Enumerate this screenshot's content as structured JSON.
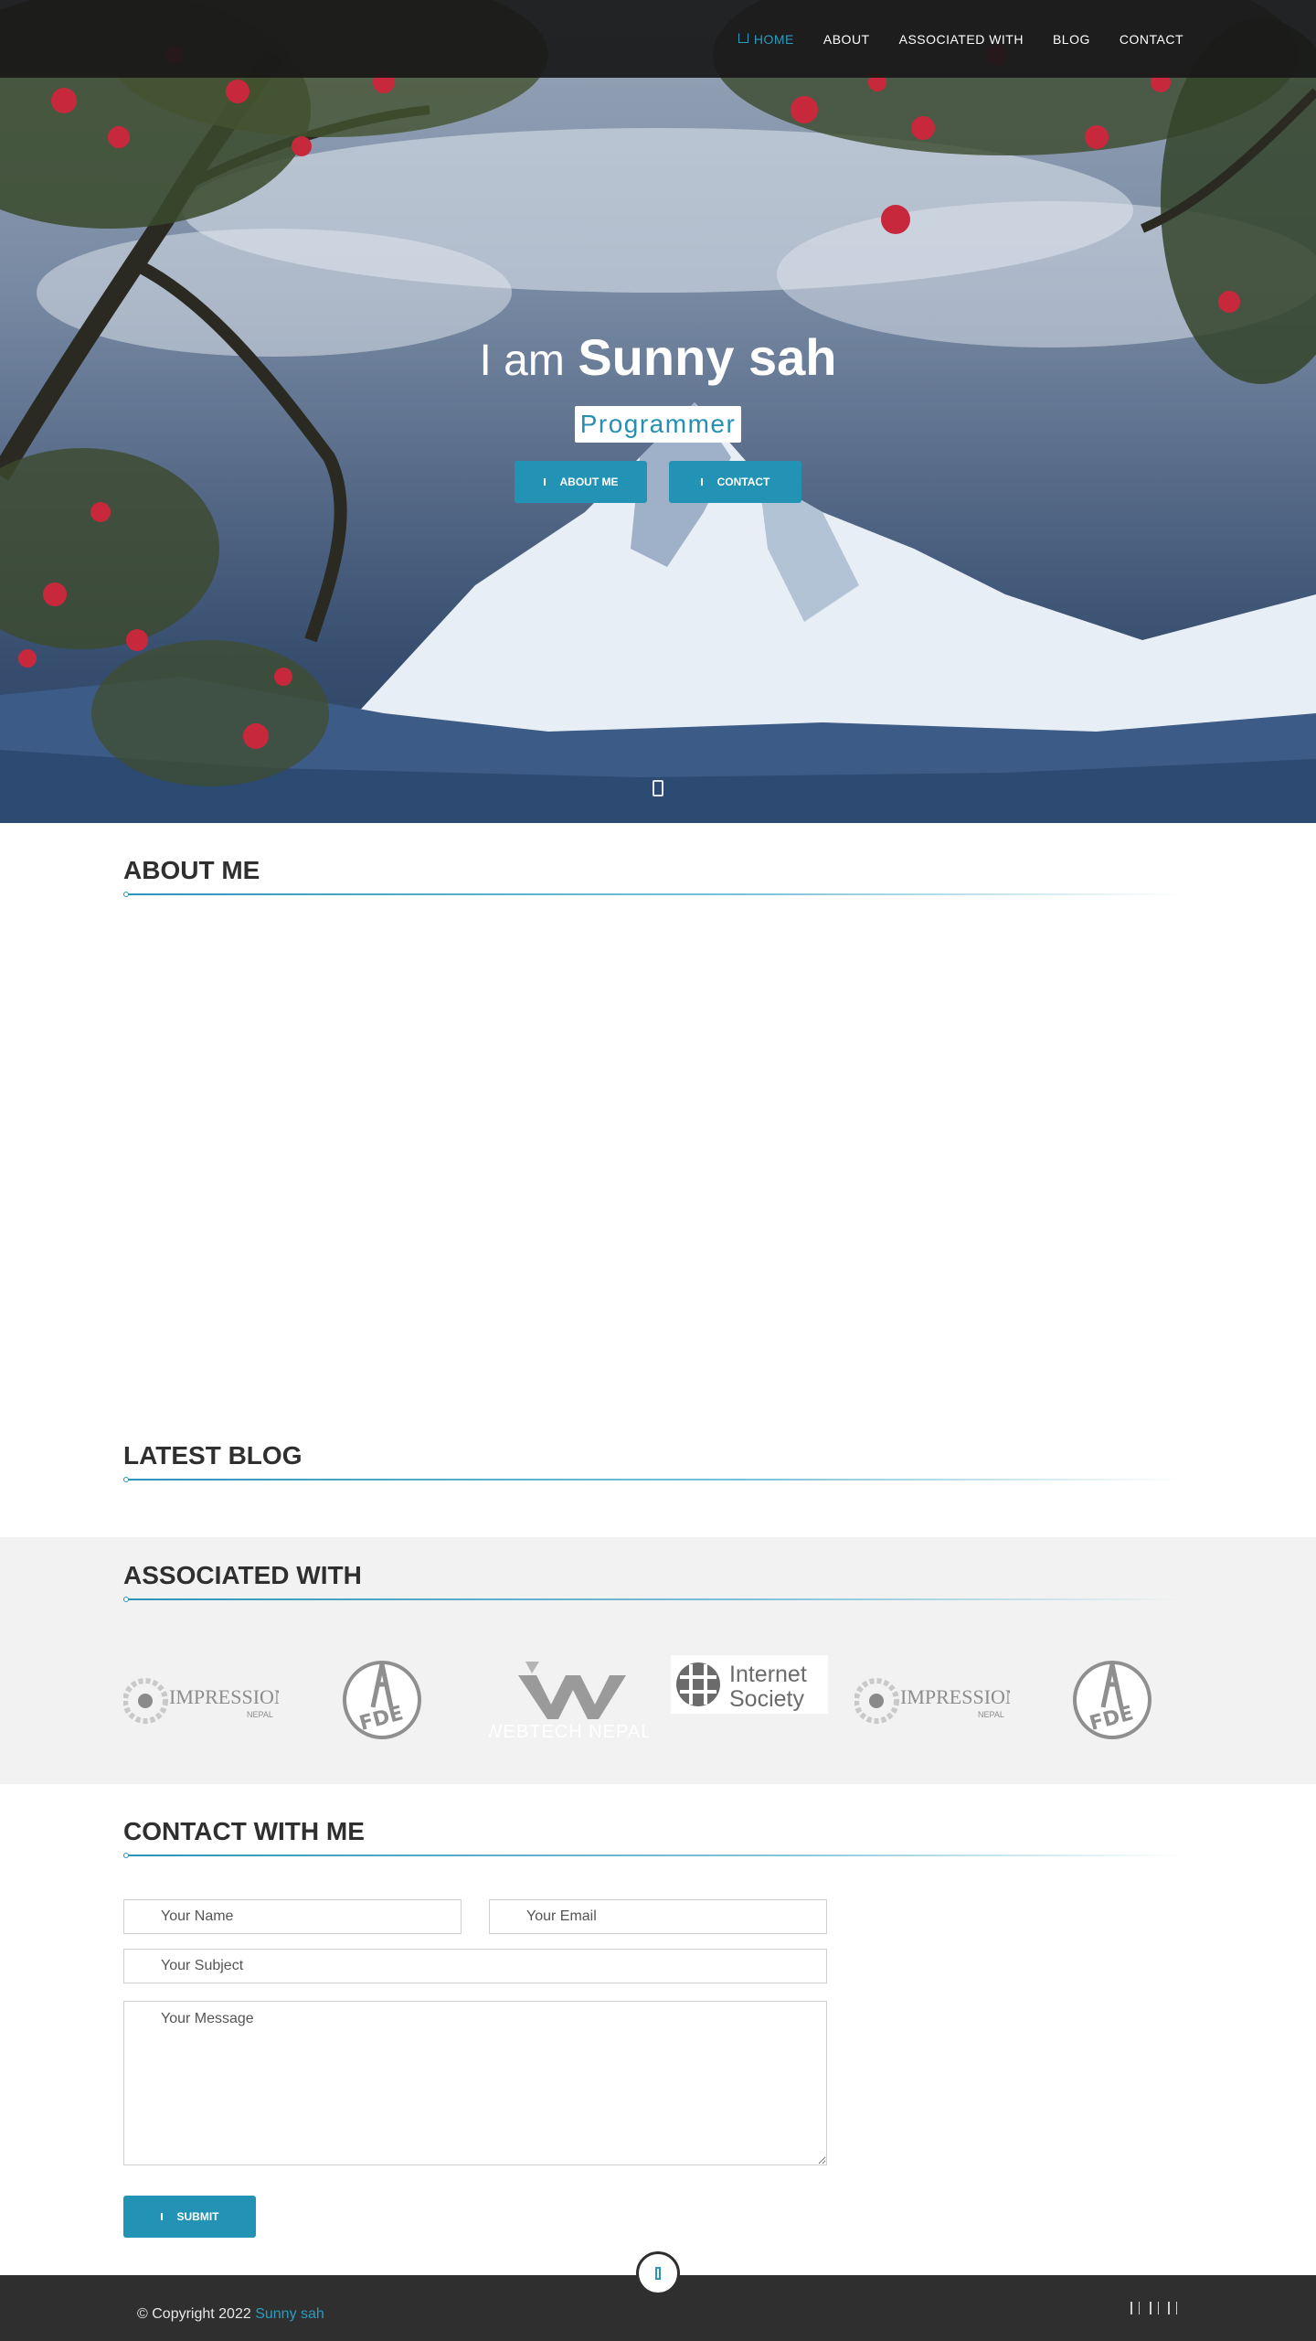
{
  "nav": {
    "items": [
      {
        "label": "HOME",
        "active": true
      },
      {
        "label": "ABOUT"
      },
      {
        "label": "ASSOCIATED WITH"
      },
      {
        "label": "BLOG"
      },
      {
        "label": "CONTACT"
      }
    ]
  },
  "hero": {
    "intro": "I am",
    "name": "Sunny sah",
    "role": "Programmer",
    "about_button": "ABOUT ME",
    "contact_button": "CONTACT"
  },
  "sections": {
    "about": "ABOUT ME",
    "blog": "LATEST BLOG",
    "associated": "ASSOCIATED WITH",
    "contact": "CONTACT WITH ME"
  },
  "logos": {
    "impression_main": "IMPRESSION",
    "impression_sub": "NEPAL",
    "fde": "FDE",
    "webtech": "WEBTECH NEPAL",
    "isoc_line1": "Internet",
    "isoc_line2": "Society"
  },
  "form": {
    "name_placeholder": "Your Name",
    "email_placeholder": "Your Email",
    "subject_placeholder": "Your Subject",
    "message_placeholder": "Your Message",
    "submit_label": "SUBMIT"
  },
  "footer": {
    "copyright": "© Copyright 2022",
    "owner": "Sunny sah"
  },
  "colors": {
    "accent": "#2393b5",
    "footer_bg": "#2f2f2f",
    "band_bg": "#f2f2f2"
  }
}
